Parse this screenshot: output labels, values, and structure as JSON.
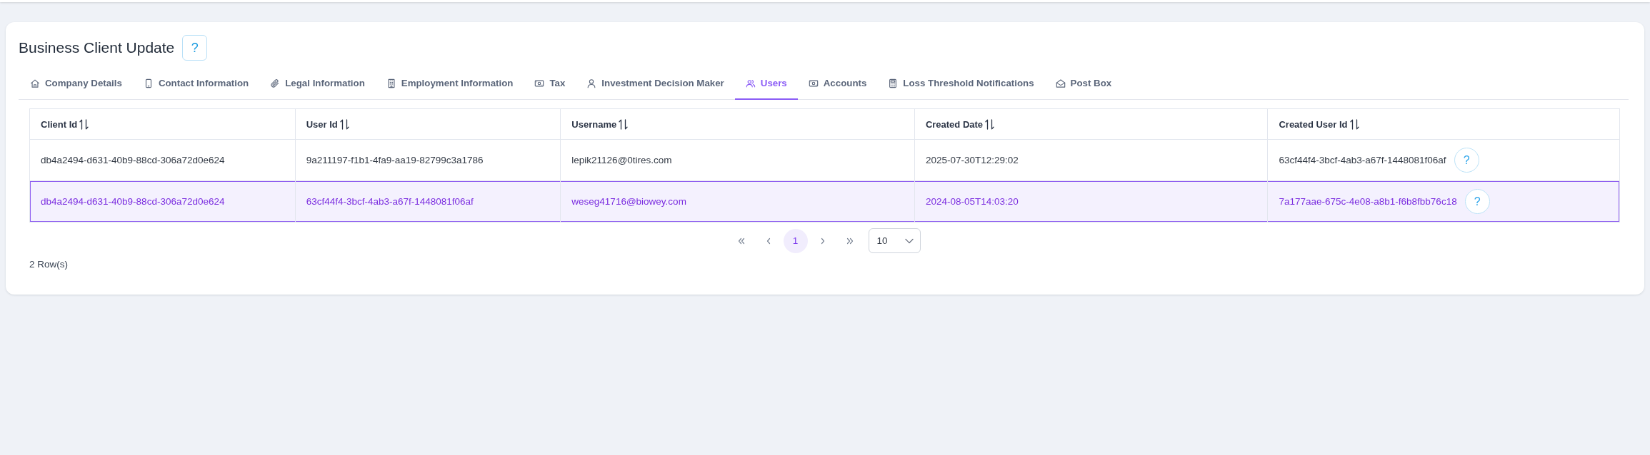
{
  "header": {
    "title": "Business Client Update",
    "help_button": "?"
  },
  "tabs": [
    {
      "label": "Company Details",
      "selected": false
    },
    {
      "label": "Contact Information",
      "selected": false
    },
    {
      "label": "Legal Information",
      "selected": false
    },
    {
      "label": "Employment Information",
      "selected": false
    },
    {
      "label": "Tax",
      "selected": false
    },
    {
      "label": "Investment Decision Maker",
      "selected": false
    },
    {
      "label": "Users",
      "selected": true
    },
    {
      "label": "Accounts",
      "selected": false
    },
    {
      "label": "Loss Threshold Notifications",
      "selected": false
    },
    {
      "label": "Post Box",
      "selected": false
    }
  ],
  "table": {
    "columns": [
      {
        "label": "Client Id",
        "sortable": true
      },
      {
        "label": "User Id",
        "sortable": true
      },
      {
        "label": "Username",
        "sortable": true
      },
      {
        "label": "Created Date",
        "sortable": true
      },
      {
        "label": "Created User Id",
        "sortable": true
      }
    ],
    "rows": [
      {
        "selected": false,
        "cells": [
          "db4a2494-d631-40b9-88cd-306a72d0e624",
          "9a211197-f1b1-4fa9-aa19-82799c3a1786",
          "lepik21126@0tires.com",
          "2025-07-30T12:29:02",
          "63cf44f4-3bcf-4ab3-a67f-1448081f06af"
        ],
        "help_button": "?"
      },
      {
        "selected": true,
        "cells": [
          "db4a2494-d631-40b9-88cd-306a72d0e624",
          "63cf44f4-3bcf-4ab3-a67f-1448081f06af",
          "weseg41716@biowey.com",
          "2024-08-05T14:03:20",
          "7a177aae-675c-4e08-a8b1-f6b8fbb76c18"
        ],
        "help_button": "?"
      }
    ]
  },
  "pagination": {
    "pages": [
      {
        "label": "1",
        "selected": true
      }
    ],
    "page_size": "10"
  },
  "row_count": "2 Row(s)"
}
